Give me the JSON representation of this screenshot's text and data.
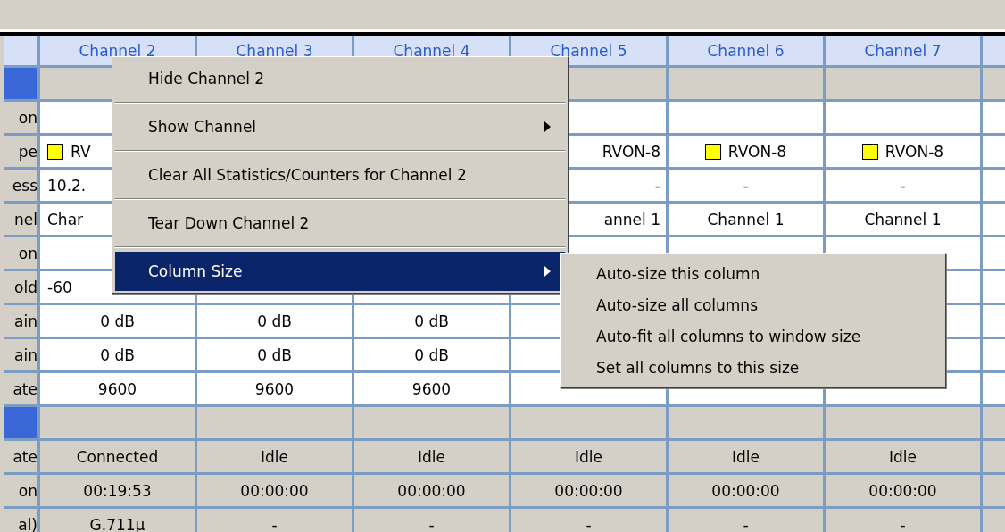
{
  "table": {
    "columns": [
      "Channel 2",
      "Channel 3",
      "Channel 4",
      "Channel 5",
      "Channel 6",
      "Channel 7"
    ],
    "rows": [
      {
        "kind": "section",
        "cells": [
          "",
          "",
          "",
          "",
          "",
          "",
          ""
        ]
      },
      {
        "kind": "config",
        "label": "on",
        "cells": [
          "",
          "",
          "",
          "",
          "",
          "",
          ""
        ]
      },
      {
        "kind": "config",
        "label": "pe",
        "cells": [
          {
            "kind": "device",
            "text": "RV"
          },
          "",
          "",
          "RVON-8",
          {
            "kind": "device",
            "text": "RVON-8"
          },
          {
            "kind": "device",
            "text": "RVON-8"
          },
          ""
        ]
      },
      {
        "kind": "config",
        "label": "ess",
        "cells": [
          "10.2.",
          "",
          "",
          "-",
          "-",
          "-",
          ""
        ]
      },
      {
        "kind": "config",
        "label": "nel",
        "cells": [
          "Char",
          "",
          "",
          "annel 1",
          "Channel 1",
          "Channel 1",
          ""
        ]
      },
      {
        "kind": "config",
        "label": "on",
        "cells": [
          "",
          "",
          "",
          "",
          "",
          "",
          ""
        ]
      },
      {
        "kind": "config",
        "label": "old",
        "cells": [
          "-60",
          "",
          "",
          "",
          "",
          "",
          ""
        ]
      },
      {
        "kind": "config",
        "label": "ain",
        "cells": [
          "0 dB",
          "0 dB",
          "0 dB",
          "",
          "",
          "",
          ""
        ]
      },
      {
        "kind": "config",
        "label": "ain",
        "cells": [
          "0 dB",
          "0 dB",
          "0 dB",
          "",
          "",
          "",
          ""
        ]
      },
      {
        "kind": "config",
        "label": "ate",
        "cells": [
          "9600",
          "9600",
          "9600",
          "",
          "",
          "",
          ""
        ]
      },
      {
        "kind": "section",
        "cells": [
          "",
          "",
          "",
          "",
          "",
          "",
          ""
        ]
      },
      {
        "kind": "status",
        "label": "ate",
        "cells": [
          "Connected",
          "Idle",
          "Idle",
          "Idle",
          "Idle",
          "Idle",
          ""
        ]
      },
      {
        "kind": "status",
        "label": "on",
        "cells": [
          "00:19:53",
          "00:00:00",
          "00:00:00",
          "00:00:00",
          "00:00:00",
          "00:00:00",
          ""
        ]
      },
      {
        "kind": "status",
        "label": "al)",
        "cells": [
          "G.711µ",
          "-",
          "-",
          "-",
          "-",
          "-",
          ""
        ]
      }
    ]
  },
  "context_menu": {
    "items": [
      {
        "label": "Hide Channel 2",
        "submenu": false,
        "selected": false
      },
      {
        "label": "Show Channel",
        "submenu": true,
        "selected": false
      },
      {
        "label": "Clear All Statistics/Counters for Channel 2",
        "submenu": false,
        "selected": false
      },
      {
        "label": "Tear Down Channel 2",
        "submenu": false,
        "selected": false
      },
      {
        "label": "Column Size",
        "submenu": true,
        "selected": true
      }
    ]
  },
  "submenu": {
    "items": [
      "Auto-size this column",
      "Auto-size all columns",
      "Auto-fit all columns to window size",
      "Set all columns to this size"
    ]
  }
}
